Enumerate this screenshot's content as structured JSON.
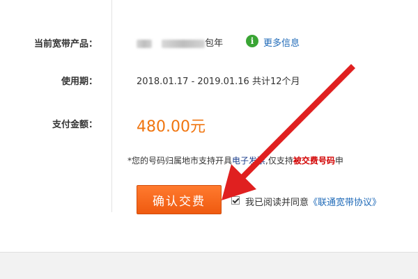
{
  "product": {
    "label": "当前宽带产品：",
    "suffix": "包年",
    "more_info": "更多信息",
    "info_icon": "i"
  },
  "period": {
    "label": "使用期：",
    "value": "2018.01.17 - 2019.01.16 共计12个月"
  },
  "payment": {
    "label": "支付金额：",
    "amount": "480.00元"
  },
  "note": {
    "prefix": "*您的号码归属地市支持开具",
    "einvoice": "电子发票",
    "middle": ",仅支持",
    "paid_number": "被交费号码",
    "tail": "申"
  },
  "confirm_button": "确认交费",
  "agreement": {
    "text": "我已阅读并同意",
    "link": "《联通宽带协议》"
  },
  "colors": {
    "accent_orange": "#f0750f",
    "button_orange": "#ef5a10",
    "link_blue": "#1f6ab8",
    "red_highlight": "#d20000",
    "arrow_red": "#e02020"
  }
}
